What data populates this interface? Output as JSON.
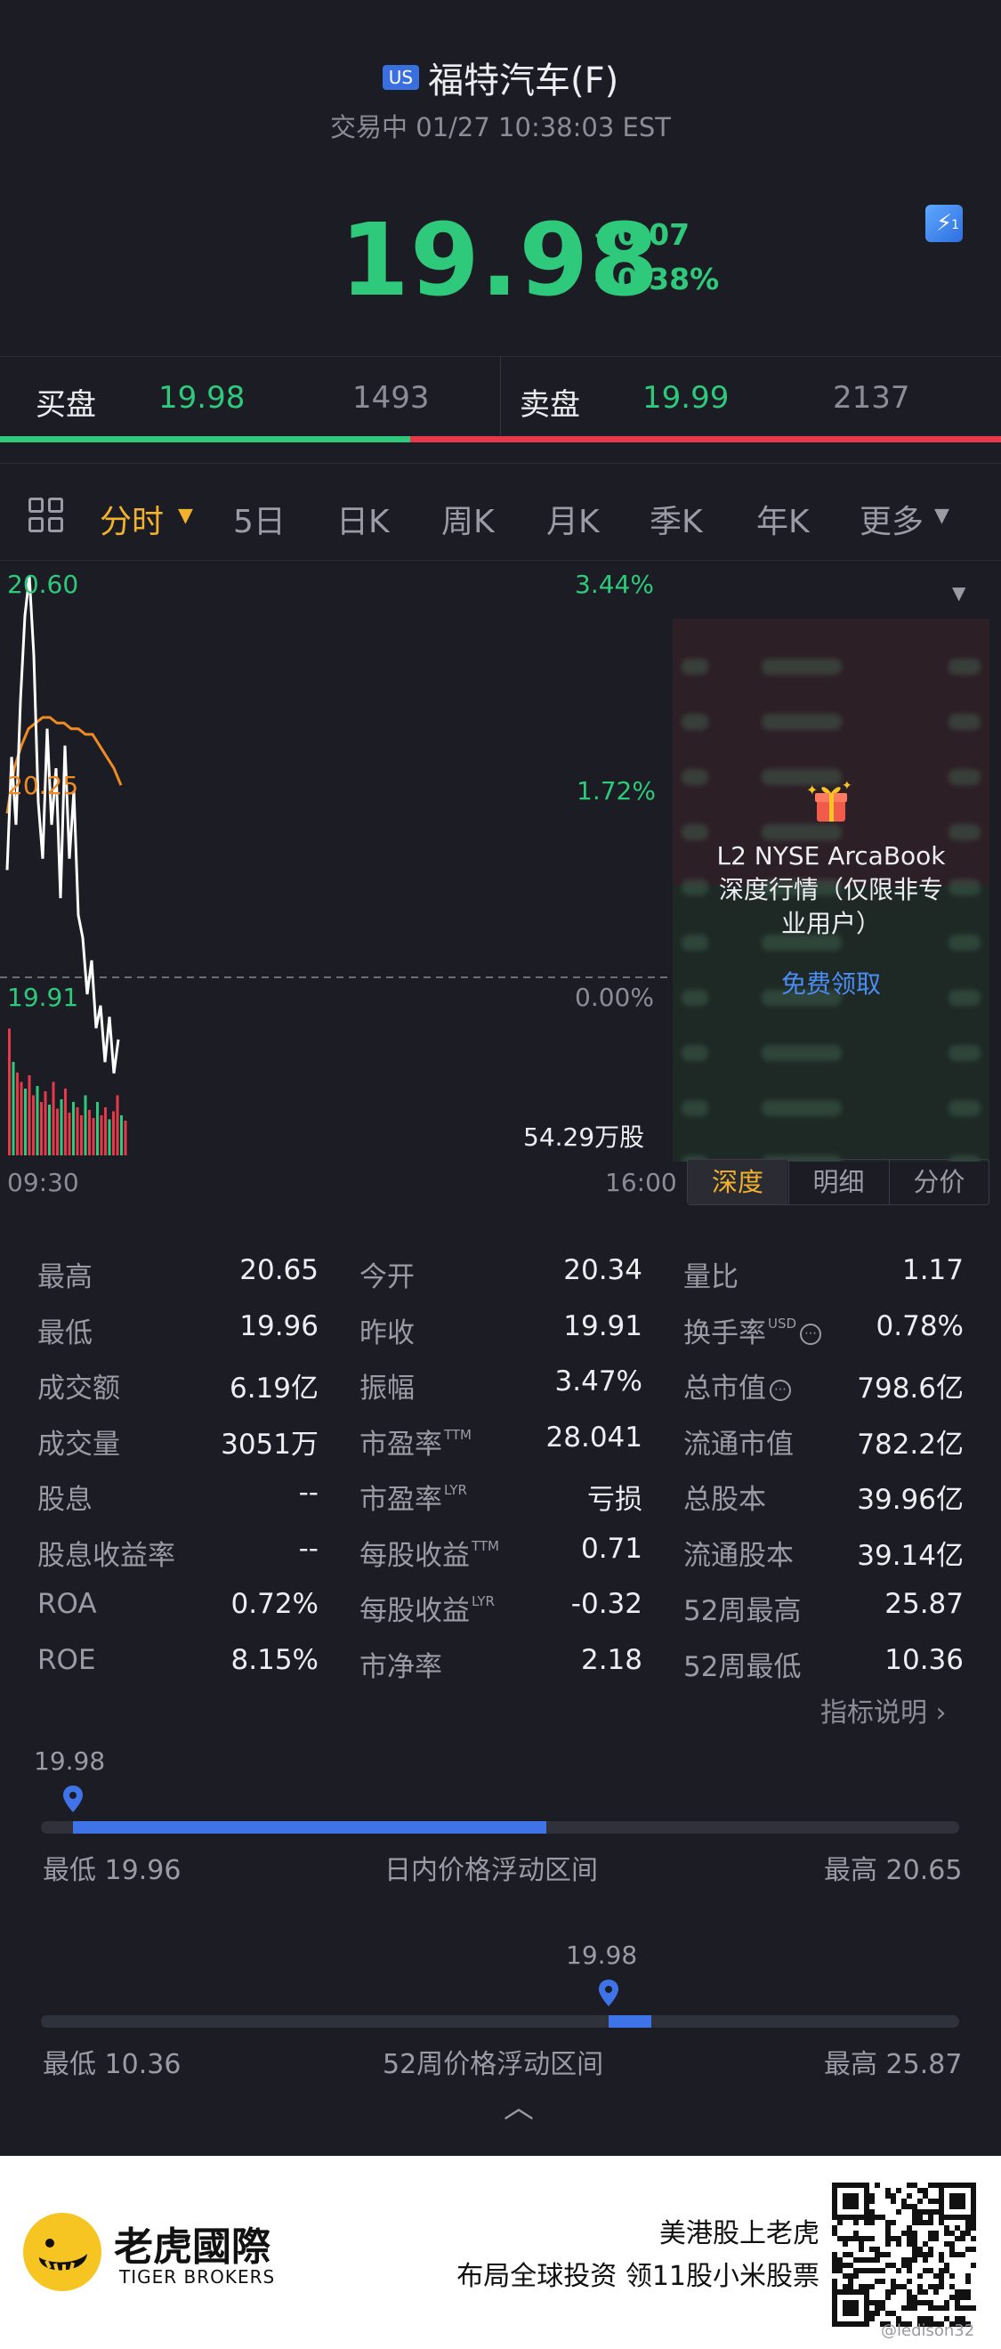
{
  "header": {
    "market_badge": "US",
    "title": "福特汽车(F)",
    "status": "交易中 01/27 10:38:03 EST",
    "price": "19.98",
    "change": "+0.07",
    "change_pct": "+0.38%",
    "flash_badge": "1"
  },
  "bidask": {
    "bid_label": "买盘",
    "bid_price": "19.98",
    "bid_size": "1493",
    "ask_label": "卖盘",
    "ask_price": "19.99",
    "ask_size": "2137",
    "bid_share": 0.41
  },
  "tabs": {
    "items": [
      "分时",
      "5日",
      "日K",
      "周K",
      "月K",
      "季K",
      "年K",
      "更多"
    ],
    "active": "分时"
  },
  "chart_data": {
    "type": "line",
    "price_axis": {
      "top": "20.60",
      "mid": "20.25",
      "bottom": "19.91"
    },
    "pct_axis": {
      "top": "3.44%",
      "mid": "1.72%",
      "bottom": "0.00%"
    },
    "time_axis": {
      "start": "09:30",
      "end": "16:00"
    },
    "volume_label": "54.29万股",
    "ylim": [
      19.91,
      20.6
    ],
    "price_series": [
      20.1,
      20.3,
      20.18,
      20.4,
      20.55,
      20.62,
      20.48,
      20.22,
      20.12,
      20.35,
      20.18,
      20.28,
      20.05,
      20.32,
      20.12,
      20.24,
      20.02,
      19.98,
      19.88,
      19.94,
      19.82,
      19.86,
      19.76,
      19.84,
      19.74,
      19.8
    ],
    "avg_series": [
      20.2,
      20.28,
      20.32,
      20.35,
      20.36,
      20.37,
      20.37,
      20.36,
      20.36,
      20.35,
      20.35,
      20.34,
      20.34,
      20.32,
      20.3,
      20.28,
      20.25
    ],
    "volume_series": [
      0.95,
      0.7,
      0.62,
      0.55,
      0.5,
      0.6,
      0.45,
      0.52,
      0.4,
      0.48,
      0.38,
      0.55,
      0.35,
      0.42,
      0.5,
      0.32,
      0.4,
      0.36,
      0.3,
      0.45,
      0.34,
      0.28,
      0.4,
      0.3,
      0.36,
      0.27,
      0.33,
      0.45,
      0.3,
      0.26
    ]
  },
  "depth": {
    "promo_line1": "L2 NYSE ArcaBook",
    "promo_line2": "深度行情（仅限非专",
    "promo_line3": "业用户）",
    "promo_link": "免费领取",
    "tabs": [
      "深度",
      "明细",
      "分价"
    ],
    "active_tab": "深度"
  },
  "stats": {
    "rows": [
      [
        {
          "label": "最高",
          "value": "20.65"
        },
        {
          "label": "今开",
          "value": "20.34"
        },
        {
          "label": "量比",
          "value": "1.17"
        }
      ],
      [
        {
          "label": "最低",
          "value": "19.96"
        },
        {
          "label": "昨收",
          "value": "19.91"
        },
        {
          "label": "换手率",
          "value": "0.78%"
        }
      ],
      [
        {
          "label": "成交额",
          "value": "6.19亿"
        },
        {
          "label": "振幅",
          "value": "3.47%"
        },
        {
          "label": "总市值",
          "value": "798.6亿"
        }
      ],
      [
        {
          "label": "成交量",
          "value": "3051万"
        },
        {
          "label": "市盈率",
          "value": "28.041"
        },
        {
          "label": "流通市值",
          "value": "782.2亿"
        }
      ],
      [
        {
          "label": "股息",
          "value": "--"
        },
        {
          "label": "市盈率",
          "value": "亏损"
        },
        {
          "label": "总股本",
          "value": "39.96亿"
        }
      ],
      [
        {
          "label": "股息收益率",
          "value": "--"
        },
        {
          "label": "每股收益",
          "value": "0.71"
        },
        {
          "label": "流通股本",
          "value": "39.14亿"
        }
      ],
      [
        {
          "label": "ROA",
          "value": "0.72%"
        },
        {
          "label": "每股收益",
          "value": "-0.32"
        },
        {
          "label": "52周最高",
          "value": "25.87"
        }
      ],
      [
        {
          "label": "ROE",
          "value": "8.15%"
        },
        {
          "label": "市净率",
          "value": "2.18"
        },
        {
          "label": "52周最低",
          "value": "10.36"
        }
      ]
    ],
    "sup_ttm": "TTM",
    "sup_lyr": "LYR",
    "sup_usd": "USD",
    "indicator_link": "指标说明"
  },
  "intraday_range": {
    "current": "19.98",
    "low_label": "最低 19.96",
    "title": "日内价格浮动区间",
    "high_label": "最高 20.65",
    "fill_start": 0.035,
    "fill_end": 0.55,
    "marker": 0.035
  },
  "week52_range": {
    "current": "19.98",
    "low_label": "最低 10.36",
    "title": "52周价格浮动区间",
    "high_label": "最高 25.87",
    "fill_start": 0.618,
    "fill_end": 0.665,
    "marker": 0.618
  },
  "ad": {
    "brand_cn": "老虎國際",
    "brand_en": "TIGER BROKERS",
    "line1": "美港股上老虎",
    "line2": "布局全球投资 领11股小米股票",
    "watermark": "@ledison32"
  },
  "colors": {
    "up": "#2ec97a",
    "down": "#e8394b",
    "accent": "#f2b22e",
    "link": "#4b8df5",
    "bg": "#1c1d24"
  }
}
